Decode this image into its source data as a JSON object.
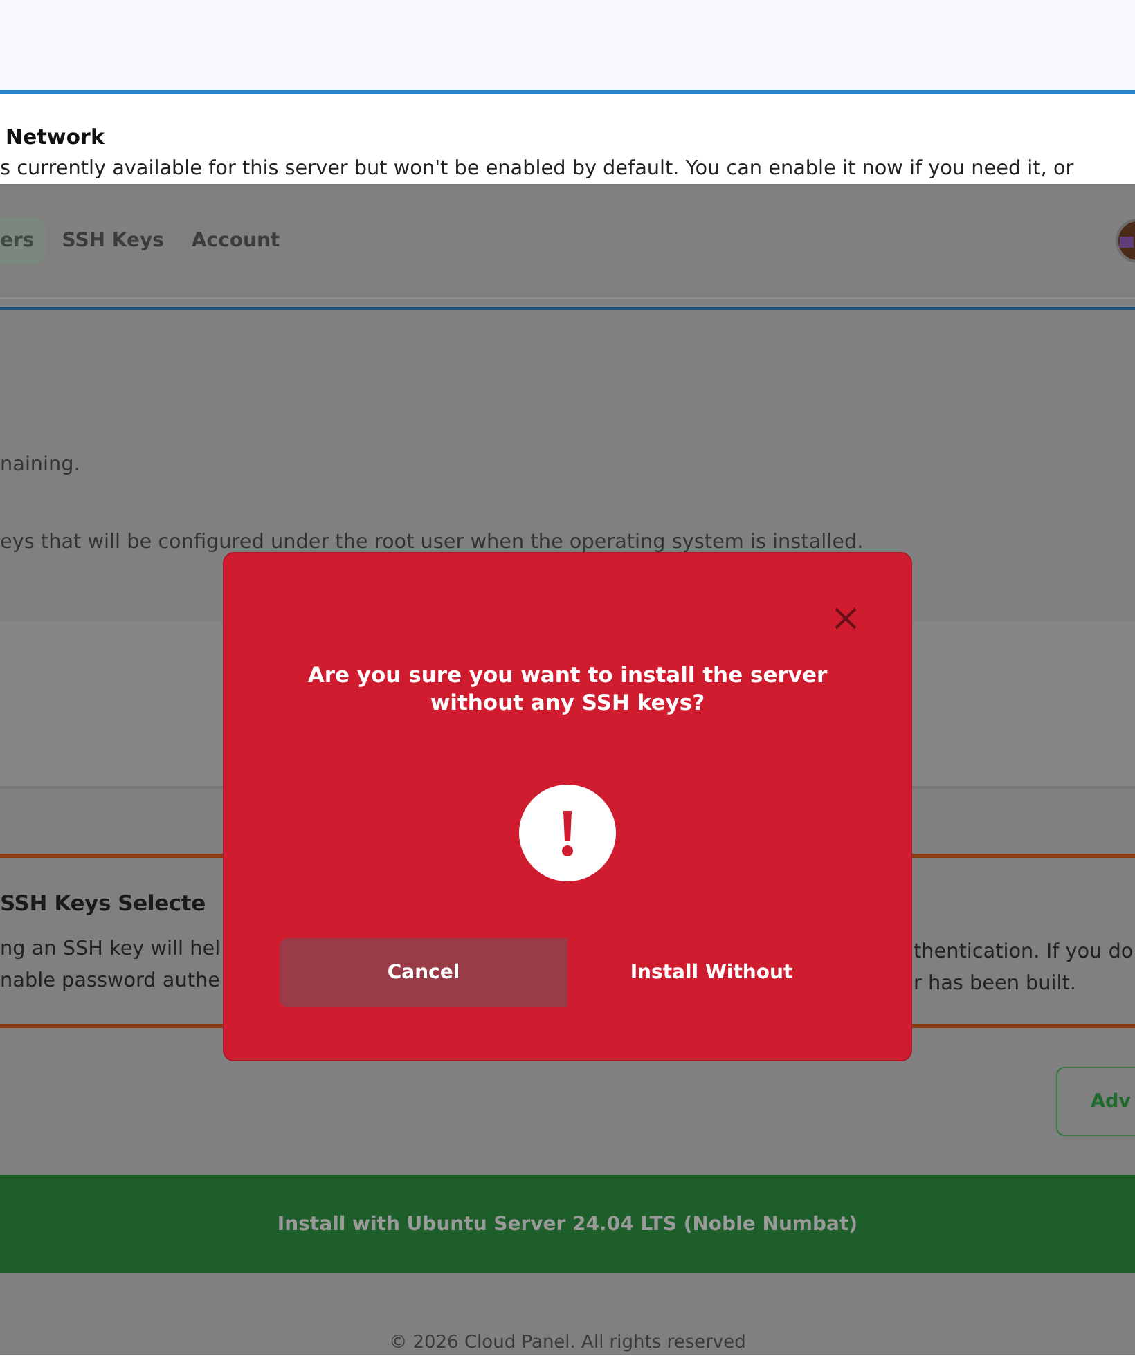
{
  "top_section": {
    "heading": "Network",
    "description": "s currently available for this server but won't be enabled by default. You can enable it now if you need it, or"
  },
  "nav": {
    "tabs": [
      {
        "label": "ers",
        "selected": true
      },
      {
        "label": "SSH Keys",
        "selected": false
      },
      {
        "label": "Account",
        "selected": false
      }
    ]
  },
  "page": {
    "remaining_text": "naining.",
    "ssh_keys_description": "eys that will be configured under the root user when the operating system is installed."
  },
  "warning": {
    "title": "SSH Keys Selecte",
    "text_left": [
      "ng an SSH key will hel",
      "nable password authe"
    ],
    "text_right": [
      "thentication. If you do",
      "r has been built."
    ]
  },
  "advanced_button": "Adv",
  "install_button": "Install with Ubuntu Server 24.04 LTS (Noble Numbat)",
  "footer": "© 2026 Cloud Panel. All rights reserved",
  "dialog": {
    "title": "Are you sure you want to install the server without any SSH keys?",
    "buttons": [
      {
        "label": "Cancel",
        "kind": "secondary"
      },
      {
        "label": "Install Without",
        "kind": "primary"
      }
    ]
  }
}
